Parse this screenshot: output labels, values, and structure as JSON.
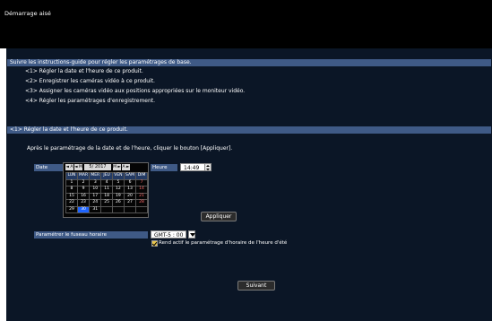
{
  "window": {
    "title": "Démarrage aisé"
  },
  "instructions": {
    "header": "Suivre les instructions-guide pour régler les paramétrages de base.",
    "steps": [
      "<1> Régler la date et l'heure de ce produit.",
      "<2> Enregistrer les caméras vidéo à ce produit.",
      "<3> Assigner les caméras vidéo aux positions appropriées sur le moniteur vidéo.",
      "<4> Régler les paramétrages d'enregistrement."
    ]
  },
  "step1": {
    "header": "<1> Régler la date et l'heure de ce produit.",
    "note": "Après le paramétrage de la date et de l'heure, cliquer le bouton [Appliquer].",
    "date_label": "Date",
    "time_label": "Heure",
    "time_value": "14:49",
    "apply_label": "Appliquer",
    "calendar": {
      "prev_year": "◄ A",
      "prev_month": "◄ M",
      "month": "5/ 2017",
      "next_month": "M ►",
      "next_year": "A ►",
      "weekdays": [
        "LUN",
        "MAR",
        "MER",
        "JEU",
        "VEN",
        "SAM",
        "DIM"
      ],
      "weeks": [
        [
          "1",
          "2",
          "3",
          "4",
          "5",
          "6",
          "7"
        ],
        [
          "8",
          "9",
          "10",
          "11",
          "12",
          "13",
          "14"
        ],
        [
          "15",
          "16",
          "17",
          "18",
          "19",
          "20",
          "21"
        ],
        [
          "22",
          "23",
          "24",
          "25",
          "26",
          "27",
          "28"
        ],
        [
          "29",
          "30",
          "31",
          "",
          "",
          "",
          ""
        ]
      ],
      "selected_day": "30"
    },
    "timezone_label": "Paramétrer le fuseau horaire",
    "timezone_value": "GMT-5 : 00",
    "dst_label": "Rend actif le paramétrage d'horaire de l'heure d'été",
    "dst_checked": true
  },
  "footer": {
    "next_label": "Suivant"
  }
}
